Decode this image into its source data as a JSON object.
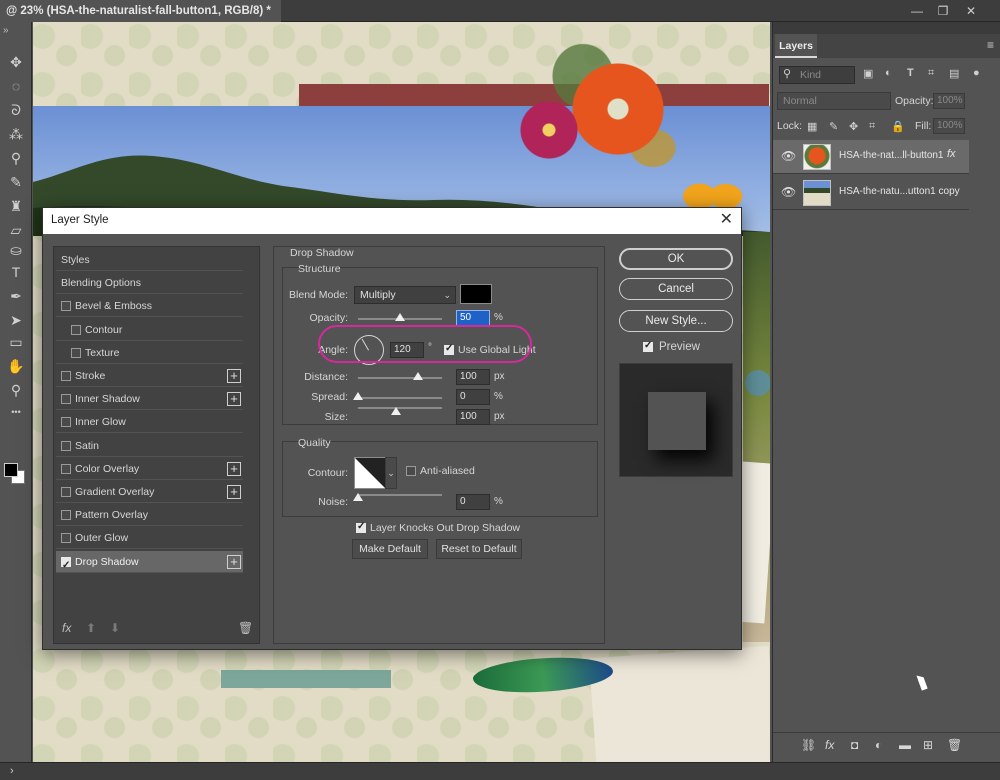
{
  "document": {
    "tab_title": "@ 23% (HSA-the-naturalist-fall-button1, RGB/8) *",
    "window_controls": [
      "—",
      "❐",
      "✕"
    ]
  },
  "toolbar": {
    "collapse": "»",
    "tools": [
      {
        "name": "move-tool-icon",
        "glyph": "✥"
      },
      {
        "name": "elliptical-marquee-icon",
        "glyph": "◌"
      },
      {
        "name": "lasso-icon",
        "glyph": "ᘐ"
      },
      {
        "name": "magic-wand-icon",
        "glyph": "⁂"
      },
      {
        "name": "eyedropper-icon",
        "glyph": "⚲"
      },
      {
        "name": "brush-icon",
        "glyph": "✎"
      },
      {
        "name": "clone-stamp-icon",
        "glyph": "♜"
      },
      {
        "name": "eraser-icon",
        "glyph": "▱"
      },
      {
        "name": "paint-bucket-icon",
        "glyph": "⛀"
      },
      {
        "name": "type-tool-icon",
        "glyph": "T"
      },
      {
        "name": "pen-tool-icon",
        "glyph": "✒"
      },
      {
        "name": "path-select-icon",
        "glyph": "➤"
      },
      {
        "name": "rectangle-tool-icon",
        "glyph": "▭"
      },
      {
        "name": "hand-tool-icon",
        "glyph": "✋"
      },
      {
        "name": "zoom-tool-icon",
        "glyph": "⚲"
      },
      {
        "name": "more-tools-icon",
        "glyph": "•••"
      }
    ]
  },
  "dialog": {
    "title": "Layer Style",
    "close": "✕",
    "styles": [
      {
        "label": "Styles",
        "checkbox": false,
        "plus": false,
        "indent": 0,
        "header": true
      },
      {
        "label": "Blending Options",
        "checkbox": false,
        "plus": false,
        "indent": 0,
        "header": true
      },
      {
        "label": "Bevel & Emboss",
        "checkbox": true,
        "checked": false,
        "plus": false,
        "indent": 0
      },
      {
        "label": "Contour",
        "checkbox": true,
        "checked": false,
        "plus": false,
        "indent": 1
      },
      {
        "label": "Texture",
        "checkbox": true,
        "checked": false,
        "plus": false,
        "indent": 1
      },
      {
        "label": "Stroke",
        "checkbox": true,
        "checked": false,
        "plus": true,
        "indent": 0
      },
      {
        "label": "Inner Shadow",
        "checkbox": true,
        "checked": false,
        "plus": true,
        "indent": 0
      },
      {
        "label": "Inner Glow",
        "checkbox": true,
        "checked": false,
        "plus": false,
        "indent": 0
      },
      {
        "label": "Satin",
        "checkbox": true,
        "checked": false,
        "plus": false,
        "indent": 0
      },
      {
        "label": "Color Overlay",
        "checkbox": true,
        "checked": false,
        "plus": true,
        "indent": 0
      },
      {
        "label": "Gradient Overlay",
        "checkbox": true,
        "checked": false,
        "plus": true,
        "indent": 0
      },
      {
        "label": "Pattern Overlay",
        "checkbox": true,
        "checked": false,
        "plus": false,
        "indent": 0
      },
      {
        "label": "Outer Glow",
        "checkbox": true,
        "checked": false,
        "plus": false,
        "indent": 0
      },
      {
        "label": "Drop Shadow",
        "checkbox": true,
        "checked": true,
        "plus": true,
        "indent": 0,
        "selected": true
      }
    ],
    "list_footer": {
      "fx": "fx",
      "up": "⬆",
      "down": "⬇",
      "trash": "🗑"
    },
    "drop_shadow": {
      "section_title": "Drop Shadow",
      "structure_title": "Structure",
      "blend_mode_label": "Blend Mode:",
      "blend_mode_value": "Multiply",
      "shadow_color": "#000000",
      "opacity_label": "Opacity:",
      "opacity_value": "50",
      "opacity_unit": "%",
      "opacity_level": 0.5,
      "angle_label": "Angle:",
      "angle_value": "120",
      "angle_unit": "°",
      "use_global_light_label": "Use Global Light",
      "use_global_light": true,
      "distance_label": "Distance:",
      "distance_value": "100",
      "distance_unit": "px",
      "distance_level": 0.72,
      "spread_label": "Spread:",
      "spread_value": "0",
      "spread_unit": "%",
      "spread_level": 0.0,
      "size_label": "Size:",
      "size_value": "100",
      "size_unit": "px",
      "size_level": 0.45,
      "quality_title": "Quality",
      "contour_label": "Contour:",
      "anti_aliased_label": "Anti-aliased",
      "anti_aliased": false,
      "noise_label": "Noise:",
      "noise_value": "0",
      "noise_unit": "%",
      "noise_level": 0.0,
      "knocks_out_label": "Layer Knocks Out Drop Shadow",
      "knocks_out": true,
      "make_default": "Make Default",
      "reset_default": "Reset to Default"
    },
    "ok": "OK",
    "cancel": "Cancel",
    "new_style": "New Style...",
    "preview_label": "Preview",
    "preview": true
  },
  "layers": {
    "tab": "Layers",
    "menu": "≡",
    "kind_placeholder": "Kind",
    "blend_mode": "Normal",
    "opacity_label": "Opacity:",
    "opacity_value": "100%",
    "lock_label": "Lock:",
    "fill_label": "Fill:",
    "fill_value": "100%",
    "items": [
      {
        "name": "HSA-the-nat...ll-button1",
        "fx": "fx",
        "selected": true,
        "visible": true
      },
      {
        "name": "HSA-the-natu...utton1 copy",
        "fx": "",
        "selected": false,
        "visible": true
      }
    ],
    "bottom_icons": [
      "⛓",
      "fx",
      "◘",
      "◐",
      "▬",
      "⊞",
      "🗑"
    ]
  },
  "status": {
    "toggle": "›"
  }
}
